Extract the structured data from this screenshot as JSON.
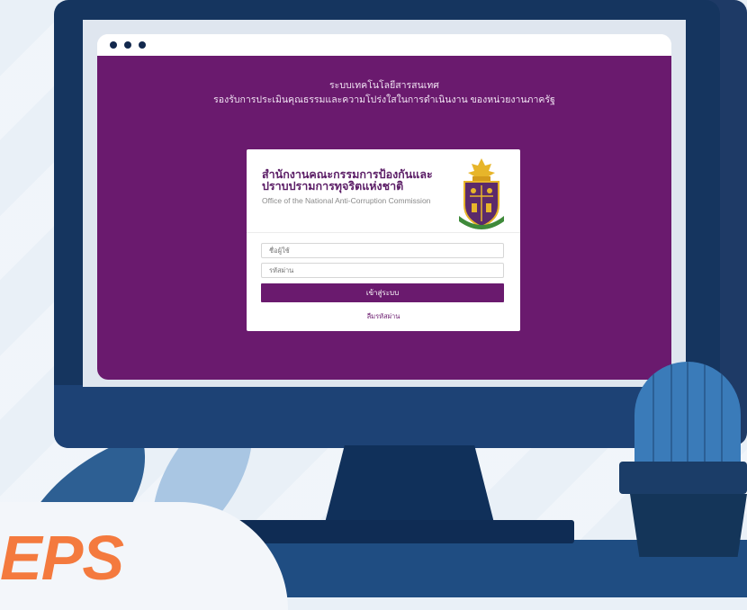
{
  "browser": {
    "window_dots": [
      "dot",
      "dot",
      "dot"
    ]
  },
  "page": {
    "header_line1": "ระบบเทคโนโลยีสารสนเทศ",
    "header_line2": "รองรับการประเมินคุณธรรมและความโปร่งใสในการดำเนินงาน ของหน่วยงานภาครัฐ",
    "background_color": "#6a1a6e"
  },
  "login": {
    "org_name_th_line1": "สำนักงานคณะกรรมการป้องกันและ",
    "org_name_th_line2": "ปราบปรามการทุจริตแห่งชาติ",
    "org_name_en": "Office of the National Anti-Corruption Commission",
    "username_placeholder": "ชื่อผู้ใช้",
    "password_placeholder": "รหัสผ่าน",
    "login_button": "เข้าสู่ระบบ",
    "forgot_password": "ลืมรหัสผ่าน",
    "emblem_icon": "nacc-emblem-icon"
  },
  "decor": {
    "brand_text": "EPS",
    "brand_color": "#f47a3e"
  }
}
